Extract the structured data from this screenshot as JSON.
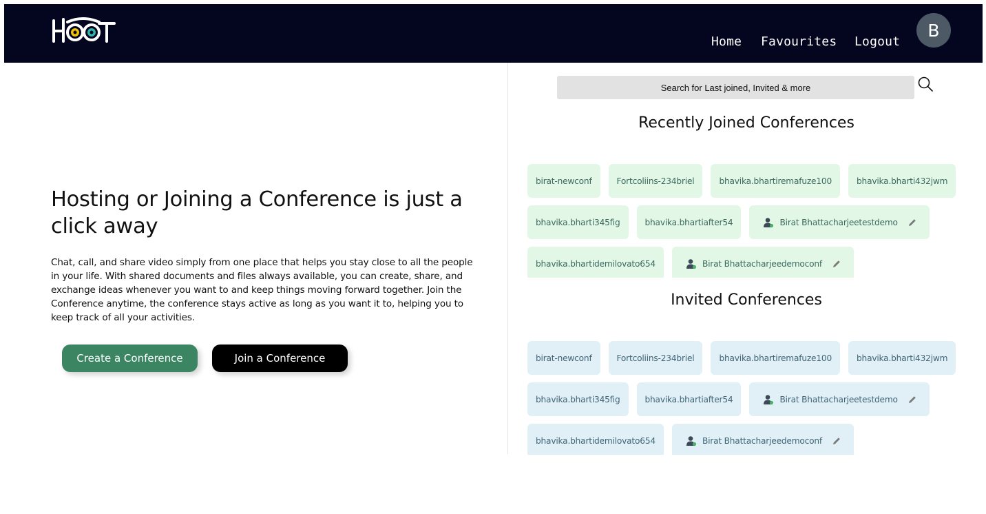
{
  "header": {
    "logo_text": "HOOT",
    "nav": [
      "Home",
      "Favourites",
      "Logout"
    ],
    "avatar_initial": "B"
  },
  "hero": {
    "title": "Hosting or Joining a Conference is just a click away",
    "description": "Chat, call, and share video simply from one place that helps you stay close to all the people in your life. With shared documents and files always available, you can create, share, and exchange ideas whenever you want to and keep things moving forward together. Join the Conference anytime, the conference stays active as long as you want it to, helping you to keep track of all your activities.",
    "create_button": "Create a Conference",
    "join_button": "Join a Conference"
  },
  "search": {
    "placeholder": "Search for Last joined, Invited & more"
  },
  "recent": {
    "title": "Recently Joined Conferences",
    "chips": [
      "birat-newconf",
      "Fortcoliins-234briel",
      "bhavika.bhartiremafuze100",
      "bhavika.bharti432jwm",
      "bhavika.bharti345fig",
      "bhavika.bhartiafter54",
      "Birat Bhattacharjeetestdemo",
      "bhavika.bhartidemilovato654",
      "Birat Bhattacharjeedemoconf"
    ]
  },
  "invited": {
    "title": "Invited Conferences",
    "chips": [
      "birat-newconf",
      "Fortcoliins-234briel",
      "bhavika.bhartiremafuze100",
      "bhavika.bharti432jwm",
      "bhavika.bharti345fig",
      "bhavika.bhartiafter54",
      "Birat Bhattacharjeetestdemo",
      "bhavika.bhartidemilovato654",
      "Birat Bhattacharjeedemoconf"
    ]
  },
  "colors": {
    "navbar": "#040620",
    "create_button": "#3c8563",
    "recent_chip": "#e3f7e6",
    "invited_chip": "#e1eff7"
  }
}
